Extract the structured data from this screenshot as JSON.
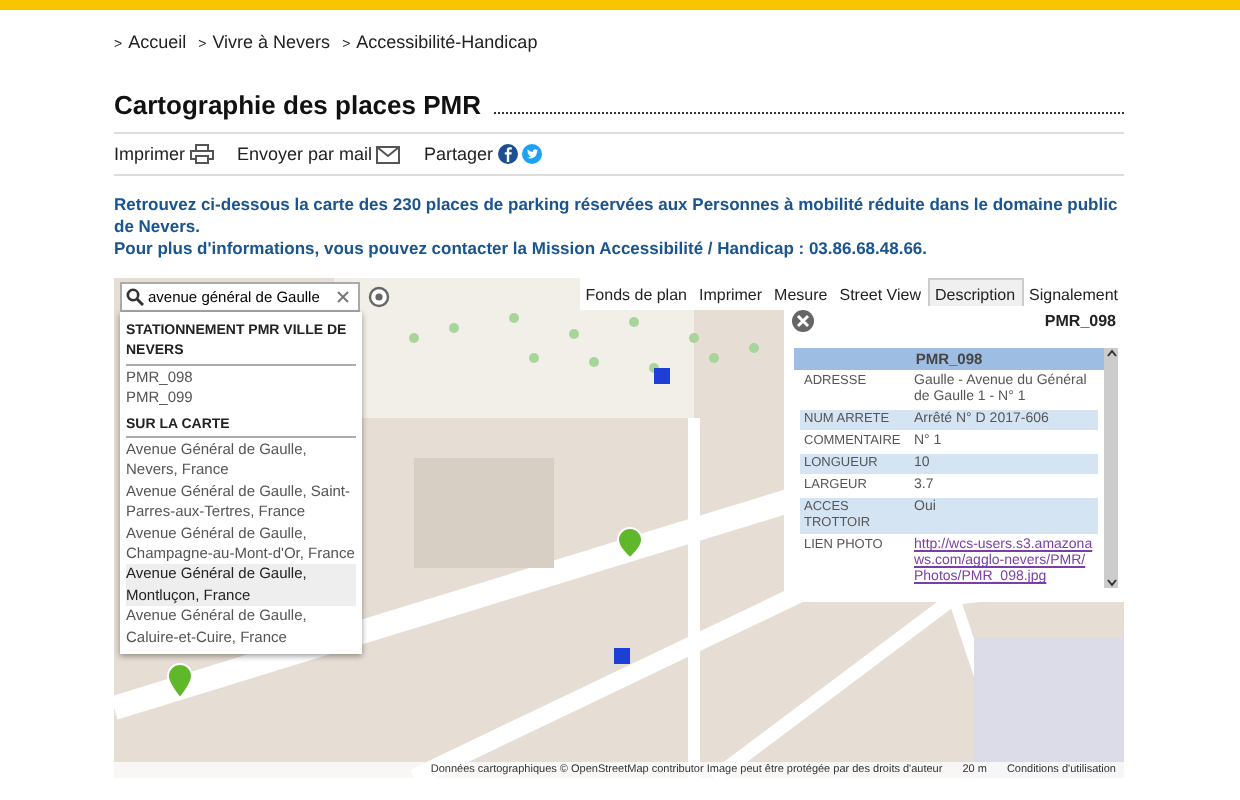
{
  "breadcrumb": [
    {
      "marker": ">",
      "label": "Accueil"
    },
    {
      "marker": ">",
      "label": "Vivre à Nevers"
    },
    {
      "marker": ">",
      "label": "Accessibilité-Handicap"
    }
  ],
  "title": "Cartographie des places PMR",
  "actions": [
    {
      "kind": "print",
      "label": "Imprimer"
    },
    {
      "kind": "mail",
      "label": "Envoyer par mail"
    },
    {
      "kind": "share",
      "label": "Partager"
    }
  ],
  "intro": [
    "Retrouvez ci-dessous la carte des 230 places de parking réservées aux Personnes à mobilité réduite dans le domaine public de Nevers.",
    "Pour plus d'informations, vous pouvez contacter la Mission Accessibilité / Handicap : 03.86.68.48.66."
  ],
  "map": {
    "search": {
      "value": "avenue général de Gaulle"
    },
    "tabs": [
      {
        "label": "Fonds de plan",
        "selected": false
      },
      {
        "label": "Imprimer",
        "selected": false
      },
      {
        "label": "Mesure",
        "selected": false
      },
      {
        "label": "Street View",
        "selected": false
      },
      {
        "label": "Description",
        "selected": true
      },
      {
        "label": "Signalement",
        "selected": false
      }
    ],
    "results": [
      {
        "title": "STATIONNEMENT PMR VILLE DE NEVERS",
        "items": [
          {
            "label": "PMR_098",
            "selected": false
          },
          {
            "label": "PMR_099",
            "selected": false
          }
        ]
      },
      {
        "title": "SUR LA CARTE",
        "items": [
          {
            "label": "Avenue Général de Gaulle, Nevers, France",
            "selected": false
          },
          {
            "label": "Avenue Général de Gaulle, Saint-Parres-aux-Tertres, France",
            "selected": false
          },
          {
            "label": "Avenue Général de Gaulle, Champagne-au-Mont-d'Or, France",
            "selected": false
          },
          {
            "label": "Avenue Général de Gaulle, Montluçon, France",
            "selected": true
          },
          {
            "label": "Avenue Général de Gaulle, Caluire-et-Cuire, France",
            "selected": false
          }
        ]
      }
    ],
    "popup": {
      "title": "PMR_098",
      "header": "PMR_098",
      "rows": [
        {
          "kind": "text",
          "label": "ADRESSE",
          "value": "Gaulle - Avenue du Général de Gaulle 1 - N° 1",
          "shaded": false
        },
        {
          "kind": "text",
          "label": "NUM ARRETE",
          "value": "Arrêté N° D 2017-606",
          "shaded": true
        },
        {
          "kind": "text",
          "label": "COMMENTAIRE",
          "value": "N° 1",
          "shaded": false
        },
        {
          "kind": "text",
          "label": "LONGUEUR",
          "value": "10",
          "shaded": true
        },
        {
          "kind": "text",
          "label": "LARGEUR",
          "value": "3.7",
          "shaded": false
        },
        {
          "kind": "text",
          "label": "ACCES TROTTOIR",
          "value": "Oui",
          "shaded": true
        },
        {
          "kind": "link",
          "label": "LIEN PHOTO",
          "value": "http://wcs-users.s3.amazonaws.com/agglo-nevers/PMR/Photos/PMR_098.jpg",
          "shaded": false
        }
      ]
    },
    "attribution": "Données cartographiques © OpenStreetMap contributor Image peut être protégée par des droits d'auteur",
    "scale": "20 m",
    "terms": "Conditions d'utilisation"
  }
}
